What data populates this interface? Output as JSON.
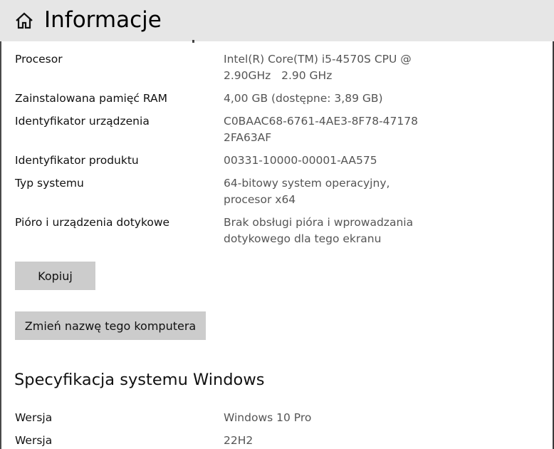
{
  "header": {
    "title": "Informacje",
    "home_icon": "home-icon"
  },
  "device_specs": [
    {
      "label": "Procesor",
      "value": "Intel(R) Core(TM) i5-4570S CPU @ 2.90GHz   2.90 GHz"
    },
    {
      "label": "Zainstalowana pamięć RAM",
      "value": "4,00 GB (dostępne: 3,89 GB)"
    },
    {
      "label": "Identyfikator urządzenia",
      "value": "C0BAAC68-6761-4AE3-8F78-47178 2FA63AF"
    },
    {
      "label": "Identyfikator produktu",
      "value": "00331-10000-00001-AA575"
    },
    {
      "label": "Typ systemu",
      "value": "64-bitowy system operacyjny, procesor x64"
    },
    {
      "label": "Pióro i urządzenia dotykowe",
      "value": "Brak obsługi pióra i wprowadzania dotykowego dla tego ekranu"
    }
  ],
  "buttons": {
    "copy": "Kopiuj",
    "rename": "Zmień nazwę tego komputera"
  },
  "windows_specs": {
    "heading": "Specyfikacja systemu Windows",
    "rows": [
      {
        "label": "Wersja",
        "value": "Windows 10 Pro"
      },
      {
        "label": "Wersja",
        "value": "22H2"
      }
    ]
  },
  "colors": {
    "titlebar_bg": "#e6e6e6",
    "button_bg": "#cccccc",
    "value_text": "#555555"
  }
}
